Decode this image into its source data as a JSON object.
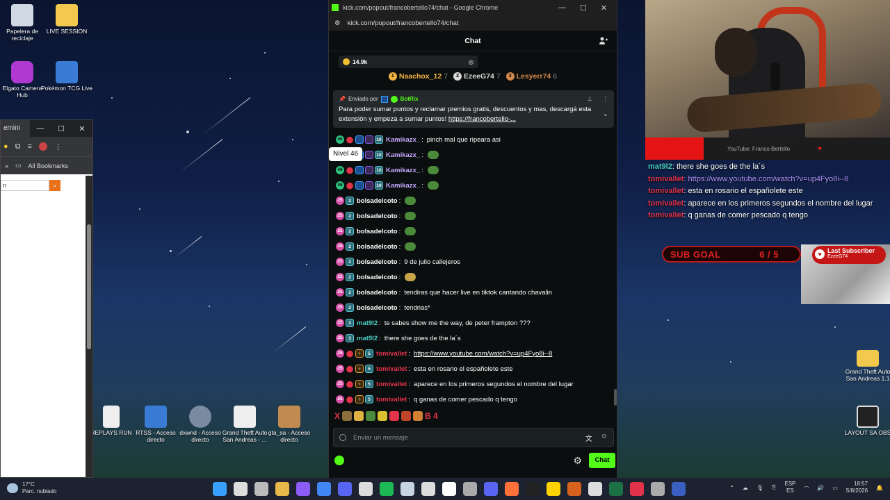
{
  "desktop": {
    "icons_top": [
      {
        "label": "Papelera de reciclaje"
      },
      {
        "label": "LIVE SESSION"
      },
      {
        "label": "Elgato Camera Hub"
      },
      {
        "label": "Pokémon TCG Live"
      }
    ],
    "icons_bottom": [
      {
        "label": "REPLAYS RUN"
      },
      {
        "label": "RTSS - Acceso directo"
      },
      {
        "label": "dxwnd - Acceso directo"
      },
      {
        "label": "Grand Theft Auto San Andreas - ..."
      },
      {
        "label": "gta_sa - Acceso directo"
      }
    ],
    "icons_right": [
      {
        "label": "Grand Theft Auto San Andreas 1.1"
      },
      {
        "label": "LAYOUT SA OBS"
      }
    ]
  },
  "left_window": {
    "tab_title": "emini",
    "bookmarks_label": "All Bookmarks",
    "search_value": "n"
  },
  "chat_window": {
    "window_title": "kick.com/popout/francobertello74/chat - Google Chrome",
    "url": "kick.com/popout/francobertello74/chat",
    "header_title": "Chat",
    "points_value": "14.9k",
    "top_gifters": [
      {
        "rank": "1",
        "name": "Naachox_12",
        "count": "7",
        "color": "#f0b340"
      },
      {
        "rank": "2",
        "name": "EzeeG74",
        "count": "7",
        "color": "#d9d9d9"
      },
      {
        "rank": "3",
        "name": "Lesyerr74",
        "count": "6",
        "color": "#d2884a"
      }
    ],
    "pinned": {
      "sent_by": "Enviado por",
      "bot_name": "BotRix",
      "message": "Para poder sumar puntos y reclamar premios gratis, descuentos y mas, descargá esta extensión y empeza a sumar puntos!",
      "link": "https://francobertello-..."
    },
    "tooltip": "Nivel 46",
    "messages": [
      {
        "user": "Kamikazx_",
        "color": "#c7a8ff",
        "text": "pinch mal que ripeara asi",
        "kind": "kami"
      },
      {
        "user": "Kamikazx_",
        "color": "#c7a8ff",
        "text": "",
        "kind": "kami"
      },
      {
        "user": "Kamikazx_",
        "color": "#c7a8ff",
        "text": "",
        "kind": "kami"
      },
      {
        "user": "Kamikazx_",
        "color": "#c7a8ff",
        "text": "",
        "kind": "kami"
      },
      {
        "user": "bolsadelcoto",
        "color": "#ffffff",
        "text": "",
        "kind": "bolsa"
      },
      {
        "user": "bolsadelcoto",
        "color": "#ffffff",
        "text": "",
        "kind": "bolsa"
      },
      {
        "user": "bolsadelcoto",
        "color": "#ffffff",
        "text": "",
        "kind": "bolsa"
      },
      {
        "user": "bolsadelcoto",
        "color": "#ffffff",
        "text": "",
        "kind": "bolsa"
      },
      {
        "user": "bolsadelcoto",
        "color": "#ffffff",
        "text": "9 de julio callejeros",
        "kind": "bolsa"
      },
      {
        "user": "bolsadelcoto",
        "color": "#ffffff",
        "text": "",
        "kind": "bolsa-gold"
      },
      {
        "user": "bolsadelcoto",
        "color": "#ffffff",
        "text": "tendiras que hacer live en tiktok cantando chavalin",
        "kind": "bolsa"
      },
      {
        "user": "bolsadelcoto",
        "color": "#ffffff",
        "text": "tendrias*",
        "kind": "bolsa"
      },
      {
        "user": "mat9l2",
        "color": "#4bd0c7",
        "text": "te sabes show me the way, de peter frampton ???",
        "kind": "mat"
      },
      {
        "user": "mat9l2",
        "color": "#4bd0c7",
        "text": "there she goes de the la´s",
        "kind": "mat"
      },
      {
        "user": "tomivallet",
        "color": "#e2334a",
        "text": "https://www.youtube.com/watch?v=up4Fyo8i--8",
        "kind": "tomi",
        "is_link": true
      },
      {
        "user": "tomivallet",
        "color": "#e2334a",
        "text": "esta en rosario el españolete este",
        "kind": "tomi"
      },
      {
        "user": "tomivallet",
        "color": "#e2334a",
        "text": "aparece en los primeros segundos el nombre del lugar",
        "kind": "tomi"
      },
      {
        "user": "tomivallet",
        "color": "#e2334a",
        "text": "q ganas de comer pescado q tengo",
        "kind": "tomi"
      }
    ],
    "badges": {
      "kami_level": "46",
      "kami_sub": "10",
      "bolsa_level": "25",
      "bolsa_sub": "2",
      "mat_level": "25",
      "mat_sub": "3",
      "tomi_level": "25",
      "tomi_sub": "5"
    },
    "emote_strip_text": "X",
    "emote_strip_tail": "B 4",
    "input_placeholder": "Enviar un mensaje",
    "send_button": "Chat"
  },
  "overlay": {
    "yt_label": "YouTube: Franco Bertello",
    "chat": [
      {
        "user": "mat9l2",
        "text": ": there she goes de the la´s",
        "type": "mat"
      },
      {
        "user": "tomivallet",
        "text": ": https://www.youtube.com/watch?v=up4Fyo8i--8",
        "type": "tomi-link"
      },
      {
        "user": "tomivallet",
        "text": ": esta en rosario el españolete este",
        "type": "tomi"
      },
      {
        "user": "tomivallet",
        "text": ": aparece en los primeros segundos el nombre del lugar",
        "type": "tomi"
      },
      {
        "user": "tomivallet",
        "text": ": q ganas de comer pescado q tengo",
        "type": "tomi"
      }
    ],
    "sub_goal_label": "SUB GOAL",
    "sub_goal_value": "6 / 5",
    "last_sub_label": "Last Subscriber",
    "last_sub_name": "EzeeG74"
  },
  "taskbar": {
    "temp": "17°C",
    "weather": "Parc. nublado",
    "lang_top": "ESP",
    "lang_bottom": "ES",
    "time": "18:57",
    "date": "5/8/2026",
    "app_icon_colors": [
      "#3aa0ff",
      "#dddddd",
      "#bbbbbb",
      "#e8b84a",
      "#8b5cf6",
      "#4285f4",
      "#5865f2",
      "#dddddd",
      "#1db954",
      "#c7d5e0",
      "#dddddd",
      "#ffffff",
      "#aaaaaa",
      "#5865f2",
      "#ff7139",
      "#222222",
      "#ffd200",
      "#d7621e",
      "#dddddd",
      "#1e7145",
      "#e2334a",
      "#aaaaaa",
      "#3b5fc0"
    ]
  }
}
